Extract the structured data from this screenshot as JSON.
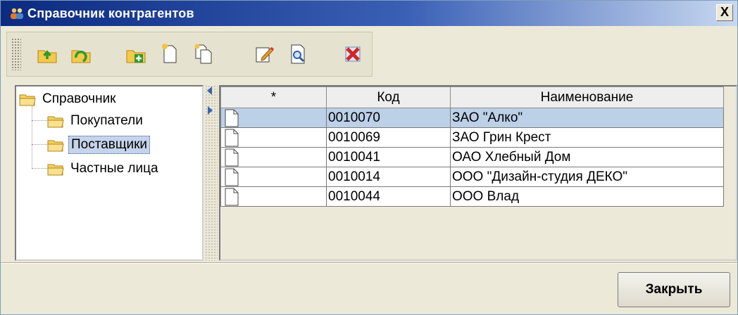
{
  "window": {
    "title": "Справочник контрагентов",
    "close_glyph": "X"
  },
  "toolbar": {
    "buttons": [
      {
        "icon": "folder-up-icon"
      },
      {
        "icon": "folder-refresh-icon"
      },
      {
        "icon": "add-folder-icon"
      },
      {
        "icon": "new-document-icon"
      },
      {
        "icon": "copy-document-icon"
      },
      {
        "icon": "edit-document-icon"
      },
      {
        "icon": "view-document-icon"
      },
      {
        "icon": "delete-icon"
      }
    ]
  },
  "tree": {
    "root": "Справочник",
    "children": [
      "Покупатели",
      "Поставщики",
      "Частные лица"
    ],
    "selected": "Поставщики"
  },
  "grid": {
    "columns": [
      "*",
      "Код",
      "Наименование"
    ],
    "rows": [
      {
        "code": "0010070",
        "name": "ЗАО \"Алко\""
      },
      {
        "code": "0010069",
        "name": "ЗАО Грин Крест"
      },
      {
        "code": "0010041",
        "name": "ОАО Хлебный Дом"
      },
      {
        "code": "0010014",
        "name": "ООО \"Дизайн-студия ДЕКО\""
      },
      {
        "code": "0010044",
        "name": "ООО Влад"
      }
    ],
    "selected_row": 0
  },
  "footer": {
    "close_label": "Закрыть"
  },
  "colors": {
    "title_bar": "#0b2a80",
    "selection": "#bcd0e8",
    "window_bg": "#ece9d8"
  }
}
